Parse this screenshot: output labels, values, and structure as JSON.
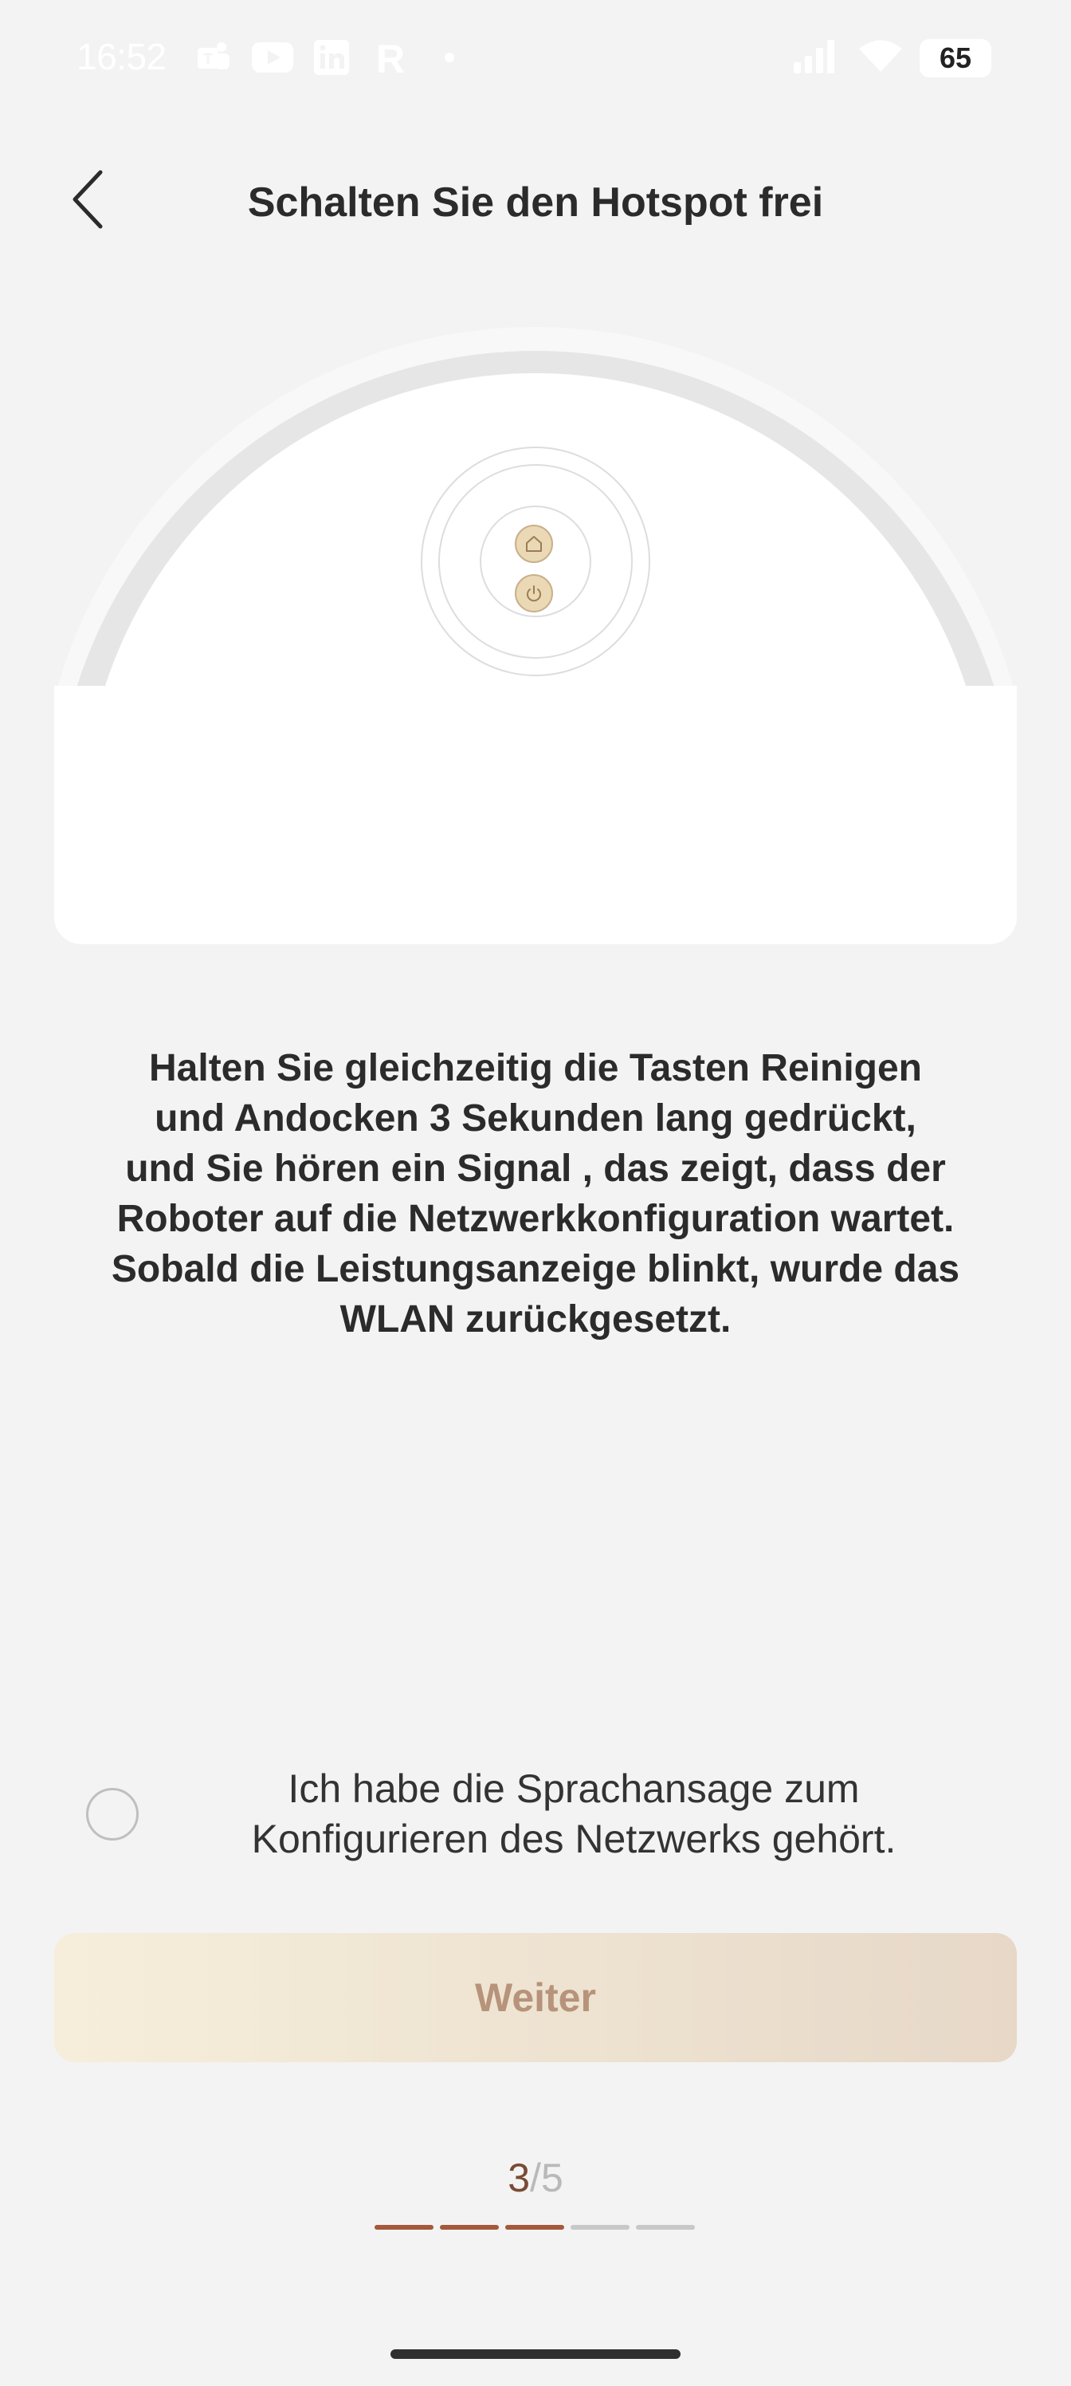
{
  "status_bar": {
    "time": "16:52",
    "battery": "65",
    "left_icons": [
      "teams-icon",
      "youtube-icon",
      "linkedin-icon",
      "r-app-icon",
      "dot-icon"
    ],
    "right_icons": [
      "signal-icon",
      "wifi-icon"
    ]
  },
  "header": {
    "title": "Schalten Sie den Hotspot frei",
    "back_icon": "chevron-left-icon"
  },
  "illustration": {
    "button_icons": [
      "home-icon",
      "power-icon"
    ]
  },
  "instructions": {
    "lines": [
      "Halten Sie gleichzeitig die Tasten Reinigen",
      "und Andocken 3 Sekunden lang gedrückt,",
      "und Sie hören ein Signal , das zeigt, dass der",
      "Roboter auf die Netzwerkkonfiguration wartet.",
      "Sobald die Leistungsanzeige blinkt, wurde das",
      "WLAN zurückgesetzt."
    ]
  },
  "confirmation": {
    "checked": false,
    "lines": [
      "Ich habe die Sprachansage zum",
      "Konfigurieren des Netzwerks gehört."
    ]
  },
  "next_button": {
    "label": "Weiter",
    "enabled": false
  },
  "progress": {
    "current": "3",
    "separator": "/",
    "total": "5",
    "active_color": "#a5593c",
    "inactive_color": "#c8c8c8"
  },
  "colors": {
    "background": "#f3f3f3",
    "button_gradient_start": "#f6eedb",
    "button_gradient_end": "#e7d8c8",
    "button_text": "#b6937a"
  }
}
